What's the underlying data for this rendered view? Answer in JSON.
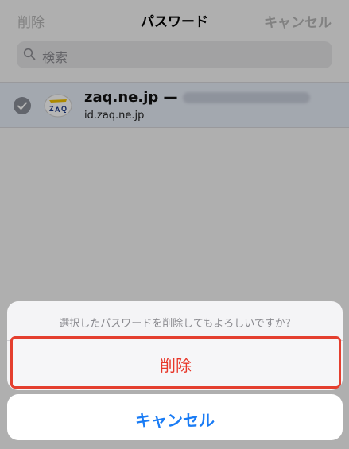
{
  "navbar": {
    "delete_label": "削除",
    "title": "パスワード",
    "cancel_label": "キャンセル"
  },
  "search": {
    "placeholder": "検索"
  },
  "password_list": {
    "items": [
      {
        "site": "zaq.ne.jp —",
        "domain": "id.zaq.ne.jp",
        "selected": true,
        "logo": "zaq-logo-icon"
      }
    ]
  },
  "action_sheet": {
    "message": "選択したパスワードを削除してもよろしいですか?",
    "delete_label": "削除",
    "cancel_label": "キャンセル"
  },
  "colors": {
    "destructive": "#e8372a",
    "accent": "#1a7cf5",
    "highlight_border": "#e43f2f"
  }
}
